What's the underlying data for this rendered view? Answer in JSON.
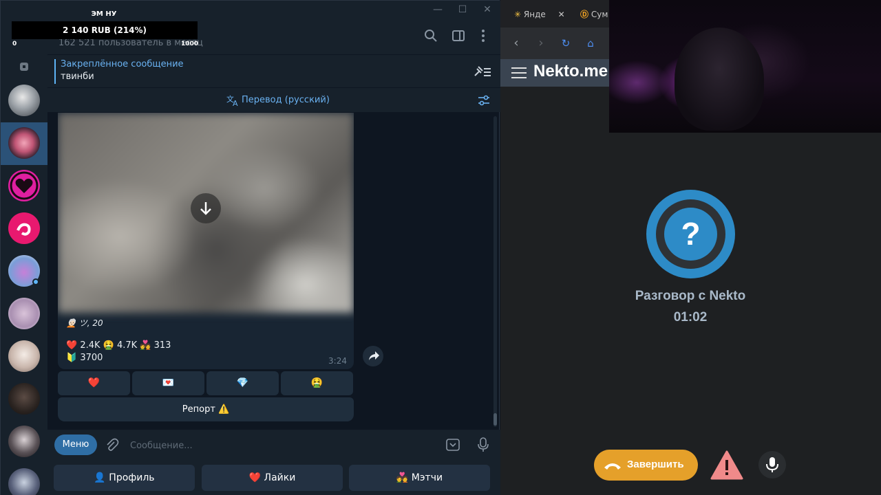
{
  "donation": {
    "title": "ЭМ НУ",
    "amount": "2 140 RUB (214%)",
    "min": "0",
    "max": "1000",
    "progress_percent": 214
  },
  "telegram": {
    "header": {
      "subscribers": "162 521 пользователь в месяц"
    },
    "pinned": {
      "title": "Закреплённое сообщение",
      "text": "твинби"
    },
    "translate": {
      "label": "Перевод (русский)"
    },
    "message": {
      "caption": "🧑🏻‍🦳 ツ, 20",
      "stats_line1": "❤️ 2.4K 🤮 4.7K 💑 313",
      "stats_line2": "🔰 3700",
      "time": "3:24"
    },
    "inline_buttons": [
      "❤️",
      "💌",
      "💎",
      "🤮"
    ],
    "report_button": "Репорт ⚠️",
    "composer": {
      "menu_label": "Меню",
      "placeholder": "Сообщение..."
    },
    "keyboard": [
      "👤 Профиль",
      "❤️ Лайки",
      "💑 Мэтчи"
    ]
  },
  "browser": {
    "tabs": [
      {
        "label": "Янде"
      },
      {
        "label": "Сум"
      }
    ],
    "site_logo": "Nekto.me",
    "conversation_label": "Разговор с Nekto",
    "timer": "01:02",
    "end_button": "Завершить",
    "avatar_symbol": "?"
  },
  "colors": {
    "accent": "#2d8bc7",
    "end_button": "#e5a02a",
    "warning": "#f08a8a",
    "telegram_link": "#6ab2f2"
  }
}
